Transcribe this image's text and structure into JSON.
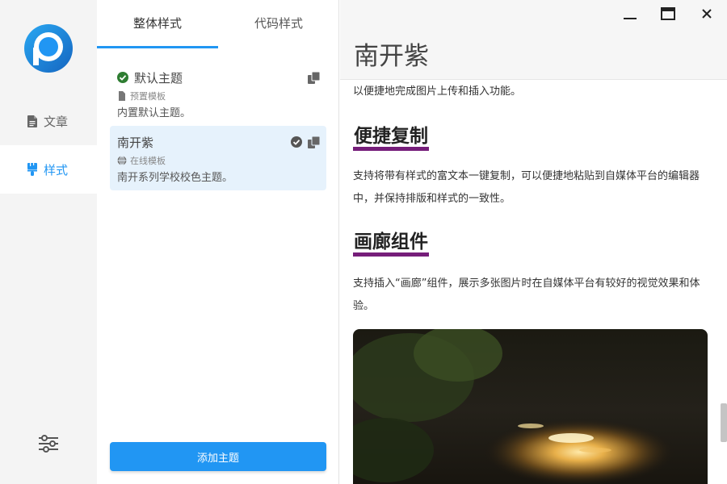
{
  "nav": {
    "items": [
      {
        "label": "文章",
        "icon": "document-icon"
      },
      {
        "label": "样式",
        "icon": "brush-icon"
      }
    ],
    "accent": "#2196f3"
  },
  "tabs": [
    {
      "label": "整体样式",
      "active": true
    },
    {
      "label": "代码样式",
      "active": false
    }
  ],
  "themes": [
    {
      "name": "默认主题",
      "source": "预置模板",
      "desc": "内置默认主题。",
      "selected": false
    },
    {
      "name": "南开紫",
      "source": "在线模板",
      "desc": "南开系列学校校色主题。",
      "selected": true
    }
  ],
  "add_theme": "添加主题",
  "preview": {
    "title": "南开紫",
    "intro": "以便捷地完成图片上传和插入功能。",
    "sections": [
      {
        "heading": "便捷复制",
        "text": "支持将带有样式的富文本一键复制，可以便捷地粘贴到自媒体平台的编辑器中，并保持排版和样式的一致性。"
      },
      {
        "heading": "画廊组件",
        "text": "支持插入“画廊”组件，展示多张图片时在自媒体平台有较好的视觉效果和体验。"
      }
    ],
    "heading_color": "#761e7a"
  }
}
